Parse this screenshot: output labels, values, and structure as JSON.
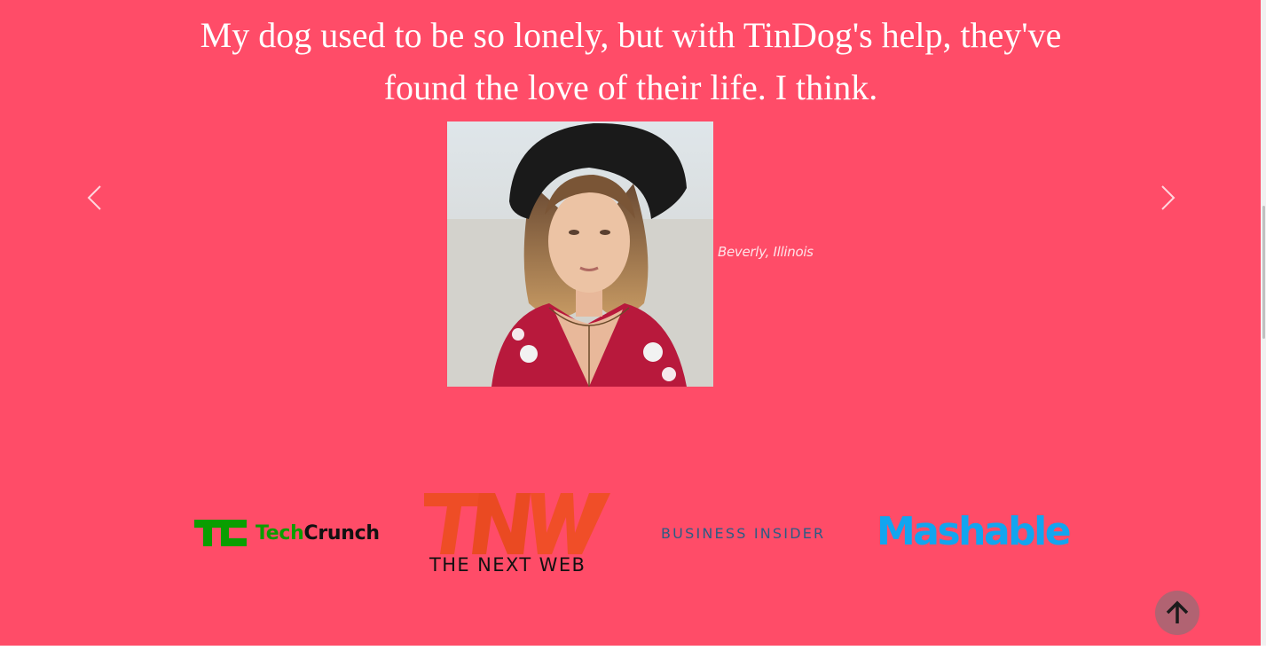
{
  "testimonial": {
    "quote": "My dog used to be so lonely, but with TinDog's help, they've found the love of their life. I think.",
    "caption": "Beverly, Illinois",
    "portrait_alt": "woman-in-black-hat-portrait"
  },
  "carousel": {
    "prev_icon": "chevron-left-icon",
    "next_icon": "chevron-right-icon"
  },
  "press": {
    "techcrunch": {
      "tech": "Tech",
      "crunch": "Crunch"
    },
    "tnw": {
      "tagline": "THE NEXT WEB"
    },
    "business_insider": {
      "name": "BUSINESS INSIDER"
    },
    "mashable": {
      "name": "Mashable"
    }
  },
  "scroll_top": {
    "icon": "arrow-up-icon"
  },
  "colors": {
    "background": "#ff4c68",
    "techcrunch_green": "#0a9e01",
    "tnw_orange": "#ee4d26",
    "business_insider_blue": "#2a5d85",
    "mashable_blue": "#12a5ef",
    "scroll_button": "#b16372"
  }
}
